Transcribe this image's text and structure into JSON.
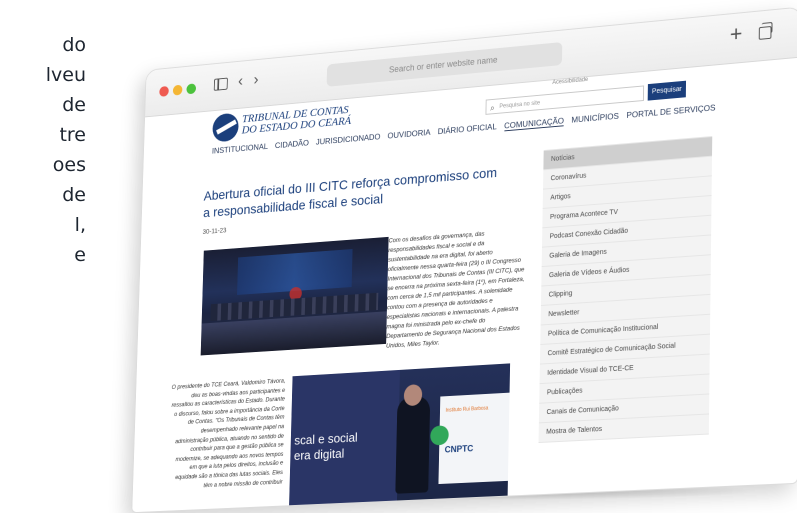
{
  "background_text": [
    "do",
    "lveu",
    "de",
    "tre",
    "oes",
    "de",
    "l,",
    "e"
  ],
  "browser": {
    "address_placeholder": "Search or enter website name",
    "back": "‹",
    "forward": "›",
    "new_tab": "+"
  },
  "header": {
    "accessibility": "Acessibilidade",
    "logo_line1": "TRIBUNAL DE CONTAS",
    "logo_line2": "DO ESTADO DO CEARÁ",
    "search_placeholder": "Pesquisa no site",
    "search_button": "Pesquisar"
  },
  "nav": [
    {
      "label": "INSTITUCIONAL",
      "active": false
    },
    {
      "label": "CIDADÃO",
      "active": false
    },
    {
      "label": "JURISDICIONADO",
      "active": false
    },
    {
      "label": "OUVIDORIA",
      "active": false
    },
    {
      "label": "DIÁRIO OFICIAL",
      "active": false
    },
    {
      "label": "COMUNICAÇÃO",
      "active": true
    },
    {
      "label": "MUNICÍPIOS",
      "active": false
    },
    {
      "label": "PORTAL DE SERVIÇOS",
      "active": false
    }
  ],
  "article": {
    "title": "Abertura oficial do III CITC reforça compromisso com a responsabilidade fiscal e social",
    "date": "30-11-23",
    "intro": "Com os desafios da governança, das responsabilidades fiscal e social e da sustentabilidade na era digital, foi aberto oficialmente nessa quarta-feira (29) o III Congresso Internacional dos Tribunais de Contas (III CITC), que se encerra na próxima sexta-feira (1º), em Fortaleza, com cerca de 1,5 mil participantes. A solenidade contou com a presença de autoridades e especialistas nacionais e internacionais. A palestra magna foi ministrada pelo ex-chefe do Departamento de Segurança Nacional dos Estados Unidos, Miles Taylor.",
    "quote": "O presidente do TCE Ceará, Valdomiro Távora, deu as boas-vindas aos participantes e ressaltou as características do Estado. Durante o discurso, falou sobre a importância da Corte de Contas. \"Os Tribunais de Contas têm desempenhado relevante papel na administração pública, atuando no sentido de contribuir para que a gestão pública se modernize, se adequando aos novos tempos em que a luta pelos direitos, inclusão e equidade são a tônica das lutas sociais. Eles têm a nobre missão de contribuir",
    "photo2_line1": "scal e social",
    "photo2_line2": "era digital",
    "photo2_logo1": "Instituto Rui Barbosa",
    "photo2_logo2": "CNPTC"
  },
  "sidebar": [
    {
      "label": "Notícias",
      "head": true
    },
    {
      "label": "Coronavírus",
      "head": false
    },
    {
      "label": "Artigos",
      "head": false
    },
    {
      "label": "Programa Acontece TV",
      "head": false
    },
    {
      "label": "Podcast Conexão Cidadão",
      "head": false
    },
    {
      "label": "Galeria de Imagens",
      "head": false
    },
    {
      "label": "Galeria de Vídeos e Áudios",
      "head": false
    },
    {
      "label": "Clipping",
      "head": false
    },
    {
      "label": "Newsletter",
      "head": false
    },
    {
      "label": "Política de Comunicação Institucional",
      "head": false
    },
    {
      "label": "Comitê Estratégico de Comunicação Social",
      "head": false
    },
    {
      "label": "Identidade Visual do TCE-CE",
      "head": false
    },
    {
      "label": "Publicações",
      "head": false
    },
    {
      "label": "Canais de Comunicação",
      "head": false
    },
    {
      "label": "Mostra de Talentos",
      "head": false
    }
  ]
}
